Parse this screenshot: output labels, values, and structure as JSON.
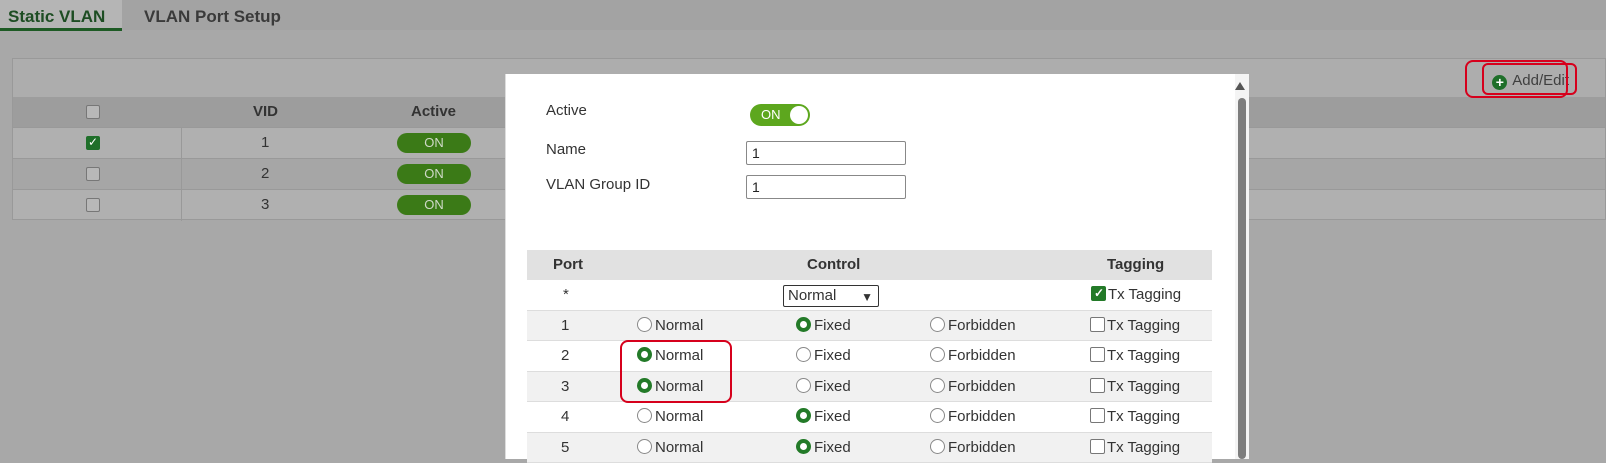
{
  "tabs": [
    {
      "label": "Static VLAN",
      "active": true
    },
    {
      "label": "VLAN Port Setup",
      "active": false
    }
  ],
  "toolbar": {
    "add_edit_label": "Add/Edit"
  },
  "vlan_table": {
    "headers": {
      "vid": "VID",
      "active": "Active"
    },
    "rows": [
      {
        "vid": "1",
        "active": "ON",
        "checked": true
      },
      {
        "vid": "2",
        "active": "ON",
        "checked": false
      },
      {
        "vid": "3",
        "active": "ON",
        "checked": false
      }
    ]
  },
  "modal": {
    "active_label": "Active",
    "active_toggle": "ON",
    "name_label": "Name",
    "name_value": "1",
    "group_id_label": "VLAN Group ID",
    "group_id_value": "1",
    "port_table": {
      "headers": {
        "port": "Port",
        "control": "Control",
        "tagging": "Tagging"
      },
      "all_row": {
        "port": "*",
        "control_select": "Normal",
        "tagging": "Tx Tagging",
        "tagging_checked": true
      },
      "options": {
        "normal": "Normal",
        "fixed": "Fixed",
        "forbidden": "Forbidden",
        "tagging": "Tx Tagging"
      },
      "rows": [
        {
          "port": "1",
          "control": "Fixed",
          "tx_tagging": false
        },
        {
          "port": "2",
          "control": "Normal",
          "tx_tagging": false
        },
        {
          "port": "3",
          "control": "Normal",
          "tx_tagging": false
        },
        {
          "port": "4",
          "control": "Fixed",
          "tx_tagging": false
        },
        {
          "port": "5",
          "control": "Fixed",
          "tx_tagging": false
        }
      ]
    }
  },
  "colors": {
    "brand_green": "#237a28",
    "toggle_green": "#5da71e",
    "highlight_red": "#d6001c"
  }
}
